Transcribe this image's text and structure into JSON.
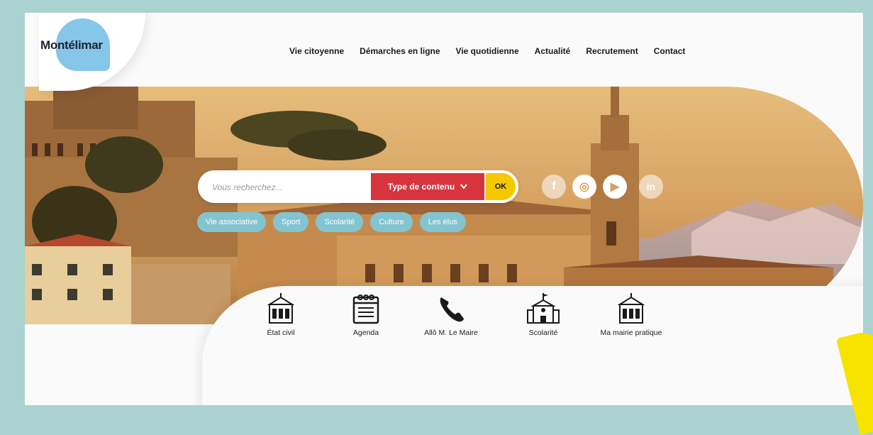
{
  "logo": {
    "text": "Montélimar"
  },
  "nav": {
    "items": [
      "Vie citoyenne",
      "Démarches en ligne",
      "Vie quotidienne",
      "Actualité",
      "Recrutement",
      "Contact"
    ]
  },
  "search": {
    "placeholder": "Vous recherchez...",
    "type_label": "Type de contenu",
    "ok_label": "OK"
  },
  "social": {
    "icons": [
      "facebook-icon",
      "instagram-icon",
      "youtube-icon",
      "linkedin-icon"
    ],
    "glyphs": [
      "f",
      "◎",
      "▶",
      "in"
    ]
  },
  "tags": [
    "Vie associative",
    "Sport",
    "Scolarité",
    "Culture",
    "Les élus"
  ],
  "quick_access": [
    {
      "label": "État civil",
      "icon": "town-hall-icon"
    },
    {
      "label": "Agenda",
      "icon": "calendar-icon"
    },
    {
      "label": "Allô M. Le Maire",
      "icon": "phone-icon"
    },
    {
      "label": "Scolarité",
      "icon": "school-icon"
    },
    {
      "label": "Ma mairie pratique",
      "icon": "town-hall-icon"
    }
  ],
  "colors": {
    "background": "#a9d2d1",
    "accent_red": "#d8343e",
    "accent_yellow": "#f5c800",
    "tag_blue": "#83c4d1",
    "logo_blue": "#85c6e9"
  }
}
